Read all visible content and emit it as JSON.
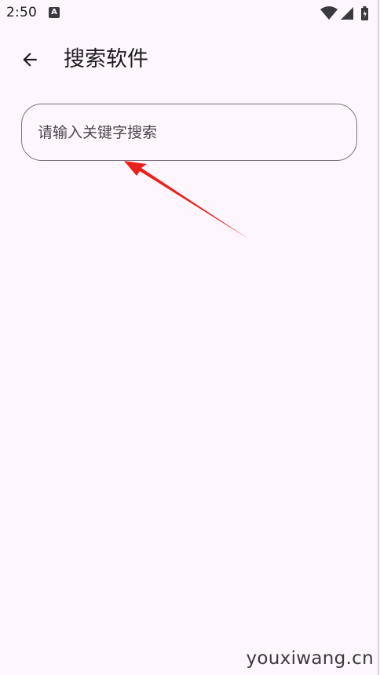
{
  "status_bar": {
    "time": "2:50",
    "notification_icon": "a-box-icon",
    "icons": [
      "wifi-icon",
      "signal-icon",
      "battery-charging-icon"
    ]
  },
  "app_bar": {
    "back_icon": "arrow-back-icon",
    "title": "搜索软件"
  },
  "search": {
    "placeholder": "请输入关键字搜索",
    "value": ""
  },
  "annotation": {
    "type": "red-arrow",
    "color": "#e8211b"
  },
  "watermark": {
    "text": "youxiwang.cn"
  },
  "colors": {
    "background": "#fdf7fd",
    "text": "#1d1b20",
    "outline": "#7a757f",
    "placeholder": "#4a4650"
  }
}
